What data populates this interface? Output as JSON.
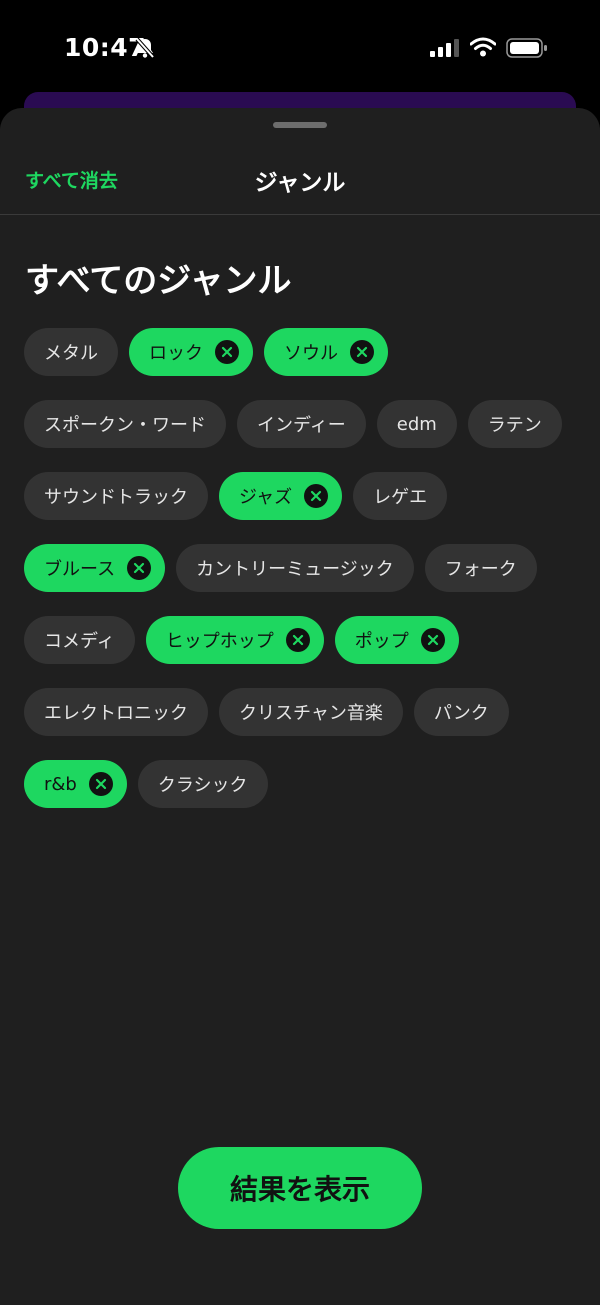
{
  "status_bar": {
    "time": "10:47",
    "icons": [
      "bell-slash-icon",
      "signal-icon",
      "wifi-icon",
      "battery-icon"
    ]
  },
  "header": {
    "clear_all": "すべて消去",
    "title": "ジャンル"
  },
  "section_title": "すべてのジャンル",
  "genres": [
    {
      "label": "メタル",
      "selected": false
    },
    {
      "label": "ロック",
      "selected": true
    },
    {
      "label": "ソウル",
      "selected": true
    },
    {
      "label": "スポークン・ワード",
      "selected": false
    },
    {
      "label": "インディー",
      "selected": false
    },
    {
      "label": "edm",
      "selected": false
    },
    {
      "label": "ラテン",
      "selected": false
    },
    {
      "label": "サウンドトラック",
      "selected": false
    },
    {
      "label": "ジャズ",
      "selected": true
    },
    {
      "label": "レゲエ",
      "selected": false
    },
    {
      "label": "ブルース",
      "selected": true
    },
    {
      "label": "カントリーミュージック",
      "selected": false
    },
    {
      "label": "フォーク",
      "selected": false
    },
    {
      "label": "コメディ",
      "selected": false
    },
    {
      "label": "ヒップホップ",
      "selected": true
    },
    {
      "label": "ポップ",
      "selected": true
    },
    {
      "label": "エレクトロニック",
      "selected": false
    },
    {
      "label": "クリスチャン音楽",
      "selected": false
    },
    {
      "label": "パンク",
      "selected": false
    },
    {
      "label": "r&b",
      "selected": true
    },
    {
      "label": "クラシック",
      "selected": false
    }
  ],
  "colors": {
    "accent": "#1ed760",
    "sheet": "#1f1f1f",
    "chip": "#333333"
  },
  "action": {
    "show_results": "結果を表示"
  }
}
